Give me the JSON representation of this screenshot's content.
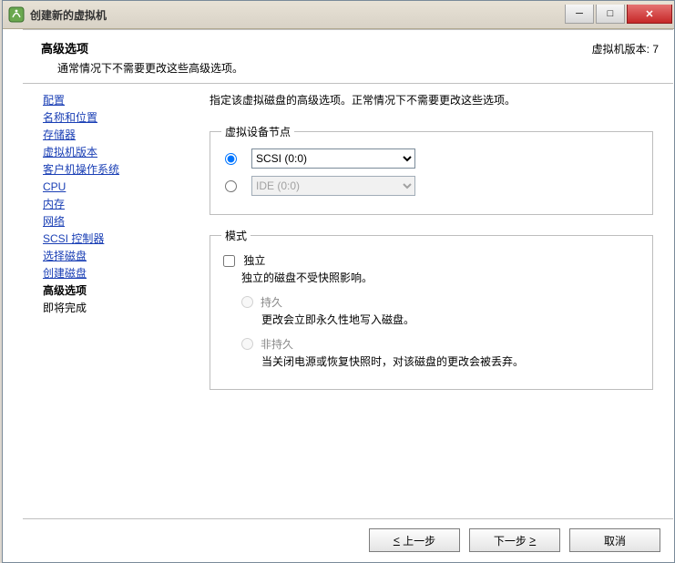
{
  "window": {
    "title": "创建新的虚拟机",
    "min_label": "─",
    "max_label": "□",
    "close_label": "✕"
  },
  "header": {
    "title": "高级选项",
    "subtitle": "通常情况下不需要更改这些高级选项。",
    "version_label": "虚拟机版本: 7"
  },
  "sidebar": {
    "items": [
      "配置",
      "名称和位置",
      "存储器",
      "虚拟机版本",
      "客户机操作系统",
      "CPU",
      "内存",
      "网络",
      "SCSI 控制器",
      "选择磁盘",
      "创建磁盘"
    ],
    "current": "高级选项",
    "next": "即将完成"
  },
  "content": {
    "desc": "指定该虚拟磁盘的高级选项。正常情况下不需要更改这些选项。",
    "node_legend": "虚拟设备节点",
    "scsi_option": "SCSI (0:0)",
    "ide_option": "IDE (0:0)",
    "mode_legend": "模式",
    "independent_label": "独立",
    "independent_desc": "独立的磁盘不受快照影响。",
    "persist_label": "持久",
    "persist_desc": "更改会立即永久性地写入磁盘。",
    "nonpersist_label": "非持久",
    "nonpersist_desc": "当关闭电源或恢复快照时，对该磁盘的更改会被丢弃。"
  },
  "footer": {
    "back": "上一步",
    "next": "下一步",
    "cancel": "取消"
  }
}
